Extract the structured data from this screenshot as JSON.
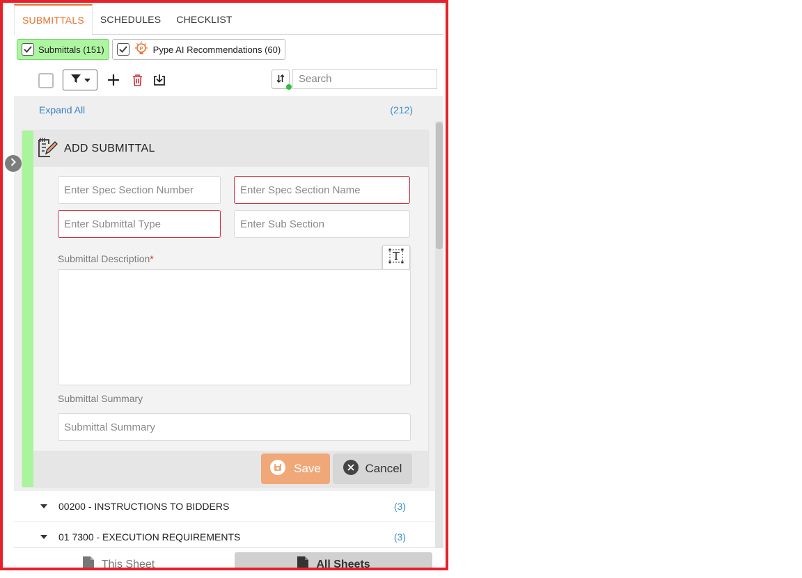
{
  "tabs": [
    {
      "label": "SUBMITTALS",
      "active": true
    },
    {
      "label": "SCHEDULES",
      "active": false
    },
    {
      "label": "CHECKLIST",
      "active": false
    }
  ],
  "chips": {
    "submittals": "Submittals (151)",
    "ai": "Pype AI Recommendations (60)"
  },
  "toolbar": {
    "search_placeholder": "Search",
    "sort_icon": "sort-arrows-icon",
    "colors": {
      "sort_dot": "#2fbf3a",
      "delete": "#d0303a"
    }
  },
  "list": {
    "expand_all": "Expand All",
    "total_count": "(212)"
  },
  "add_form": {
    "title": "ADD SUBMITTAL",
    "spec_number_placeholder": "Enter Spec Section Number",
    "spec_name_placeholder": "Enter Spec Section Name",
    "submittal_type_placeholder": "Enter Submittal Type",
    "sub_section_placeholder": "Enter Sub Section",
    "description_label": "Submittal Description",
    "required_mark": "*",
    "summary_label": "Submittal Summary",
    "summary_placeholder": "Submittal Summary",
    "save_label": "Save",
    "cancel_label": "Cancel",
    "colors": {
      "accent_bar": "#a9f59b",
      "save_bg": "#f0a878",
      "required": "#d0303a"
    }
  },
  "sections": [
    {
      "title": "00200 - INSTRUCTIONS TO BIDDERS",
      "count": "(3)"
    },
    {
      "title": "01 7300 - EXECUTION REQUIREMENTS",
      "count": "(3)"
    }
  ],
  "bottom": {
    "this_sheet": "This Sheet",
    "all_sheets": "All Sheets"
  },
  "theme": {
    "active_tab": "#e9732f",
    "link": "#3a7fc4",
    "frame_border": "#e8202a"
  }
}
